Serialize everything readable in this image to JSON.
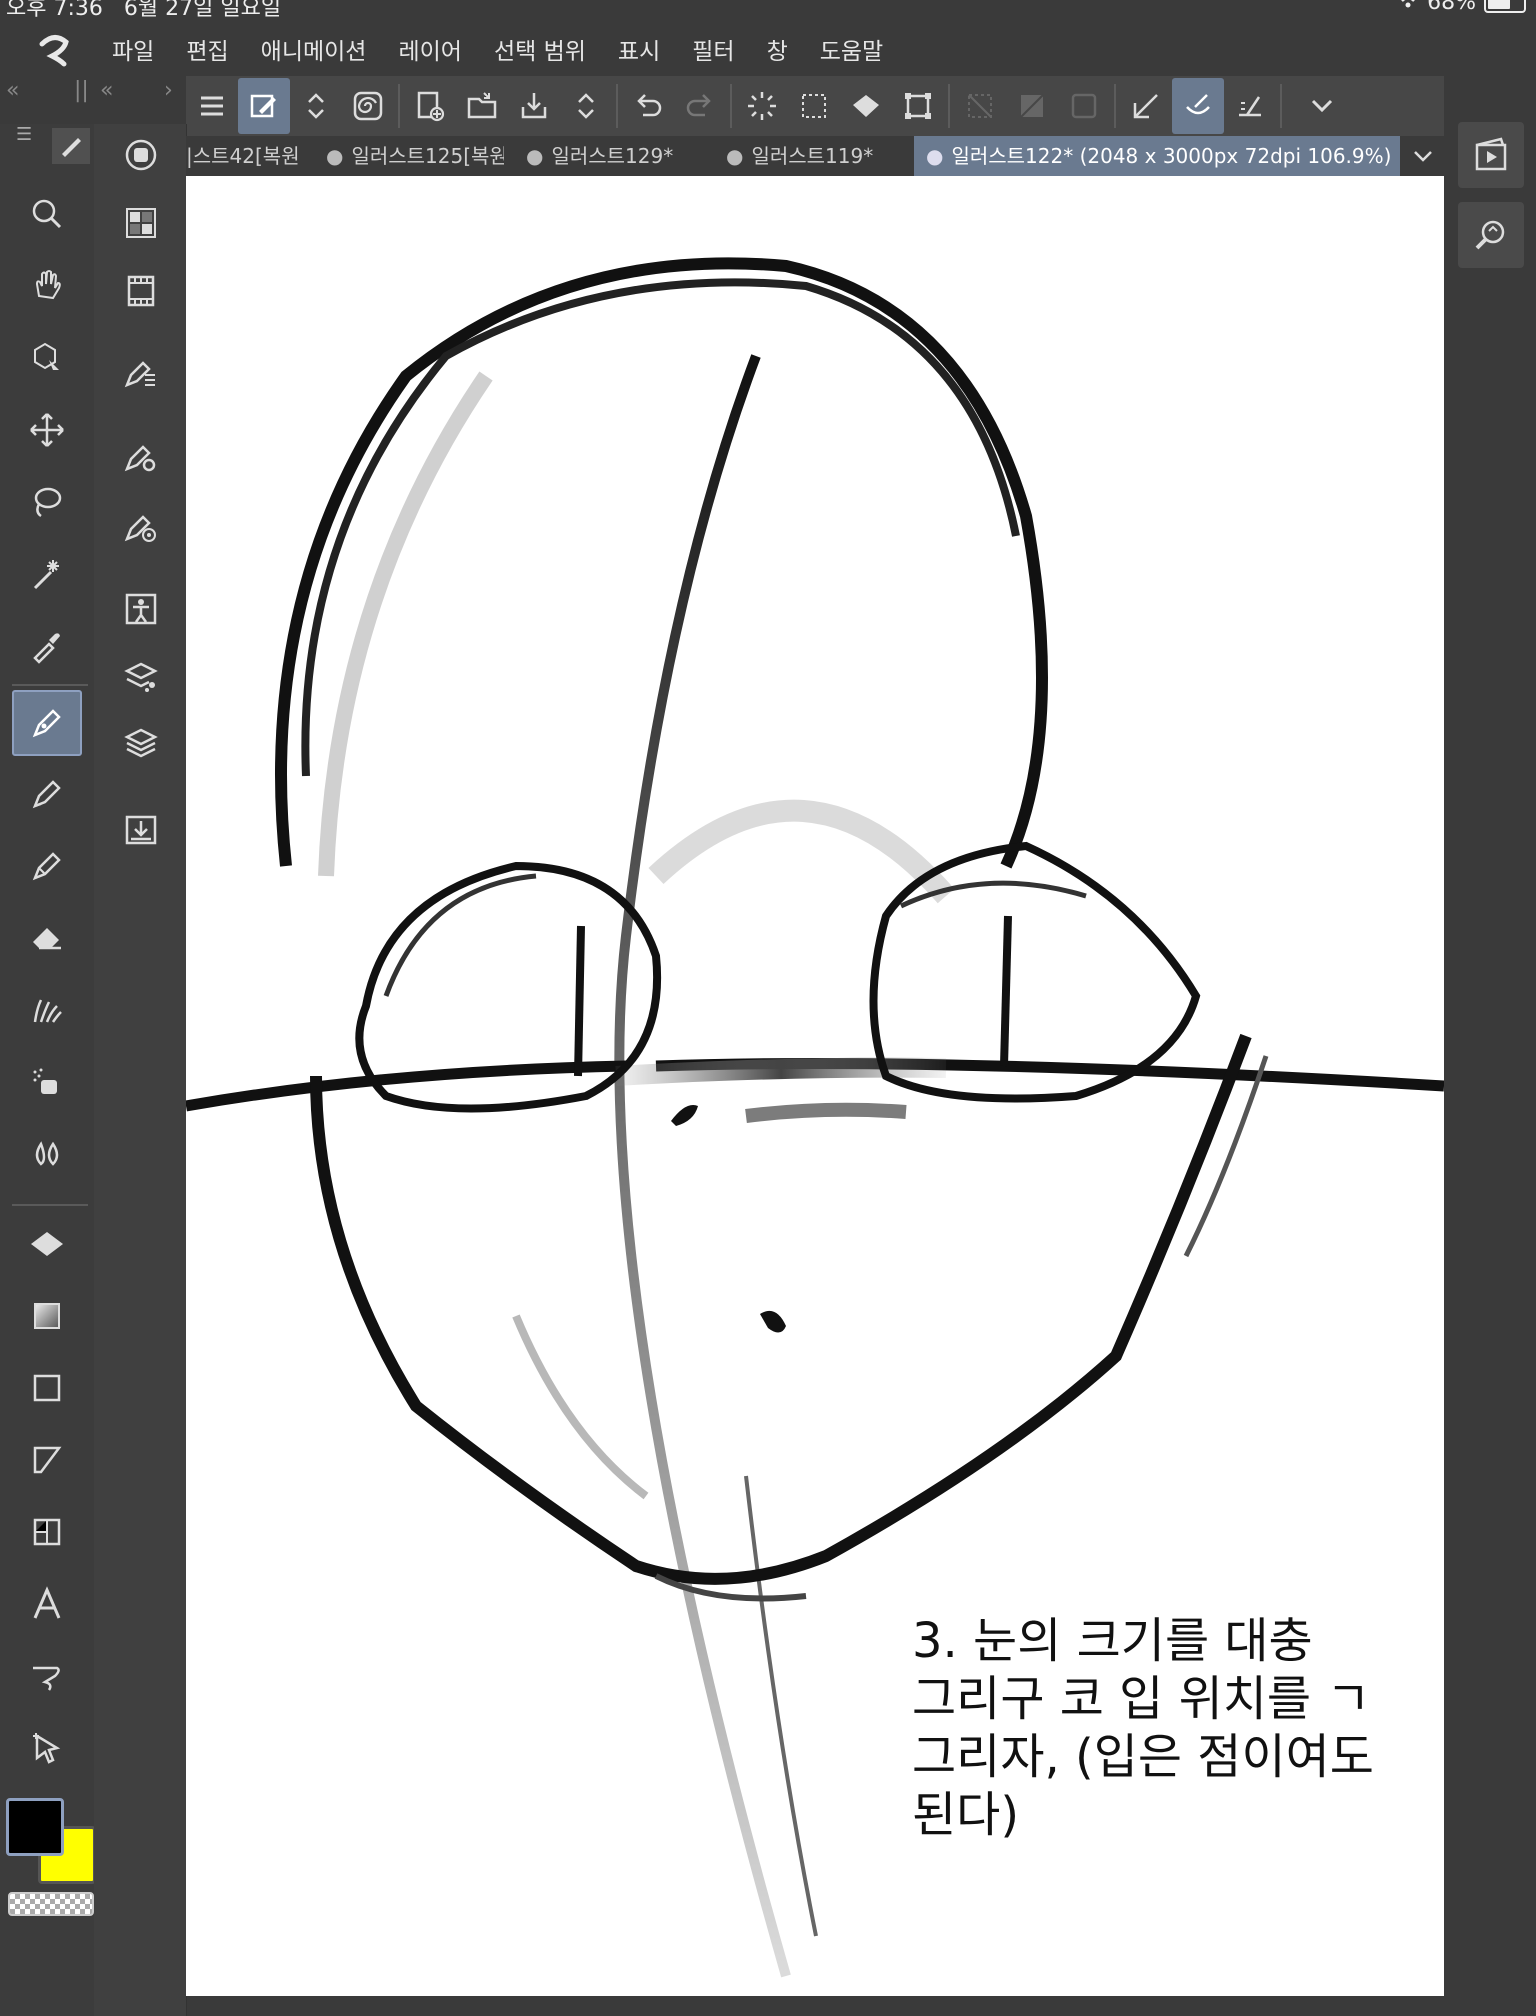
{
  "status": {
    "time": "오후 7:36",
    "date": "6월 27일 일요일",
    "battery": "68%"
  },
  "menu": [
    "파일",
    "편집",
    "애니메이션",
    "레이어",
    "선택 범위",
    "표시",
    "필터",
    "창",
    "도움말"
  ],
  "tabs": [
    {
      "label": "|스트42[복원"
    },
    {
      "label": "일러스트125[복원"
    },
    {
      "label": "일러스트129*"
    },
    {
      "label": "일러스트119*"
    },
    {
      "label": "일러스트122* (2048 x 3000px 72dpi 106.9%)"
    }
  ],
  "canvas_note": {
    "line1": "3. 눈의 크기를 대충",
    "line2": "그리구 코 입 위치를 ㄱ",
    "line3": "그리자, (입은 점이여도",
    "line4": "된다)"
  },
  "colors": {
    "main": "#000000",
    "sub": "#ffff00",
    "accent": "#6a7a90"
  },
  "tools": [
    "zoom-icon",
    "hand-icon",
    "object-icon",
    "move-icon",
    "lasso-icon",
    "magic-wand-icon",
    "eyedropper-icon",
    "pen-icon",
    "pencil-icon",
    "brush-icon",
    "eraser-icon",
    "decoration-icon",
    "airbrush-icon",
    "blend-icon",
    "fill-icon",
    "gradient-icon",
    "rectangle-icon",
    "frame-icon",
    "ruler-icon",
    "text-icon",
    "balloon-icon",
    "correct-line-icon"
  ],
  "subtools_palette": [
    "color-circle-icon",
    "color-set-icon",
    "animation-timeline-icon",
    "tool-property-icon",
    "subtool-detail-icon",
    "brush-size-icon",
    "3d-figure-icon",
    "layer-property-icon",
    "layer-icon",
    "material-icon"
  ]
}
